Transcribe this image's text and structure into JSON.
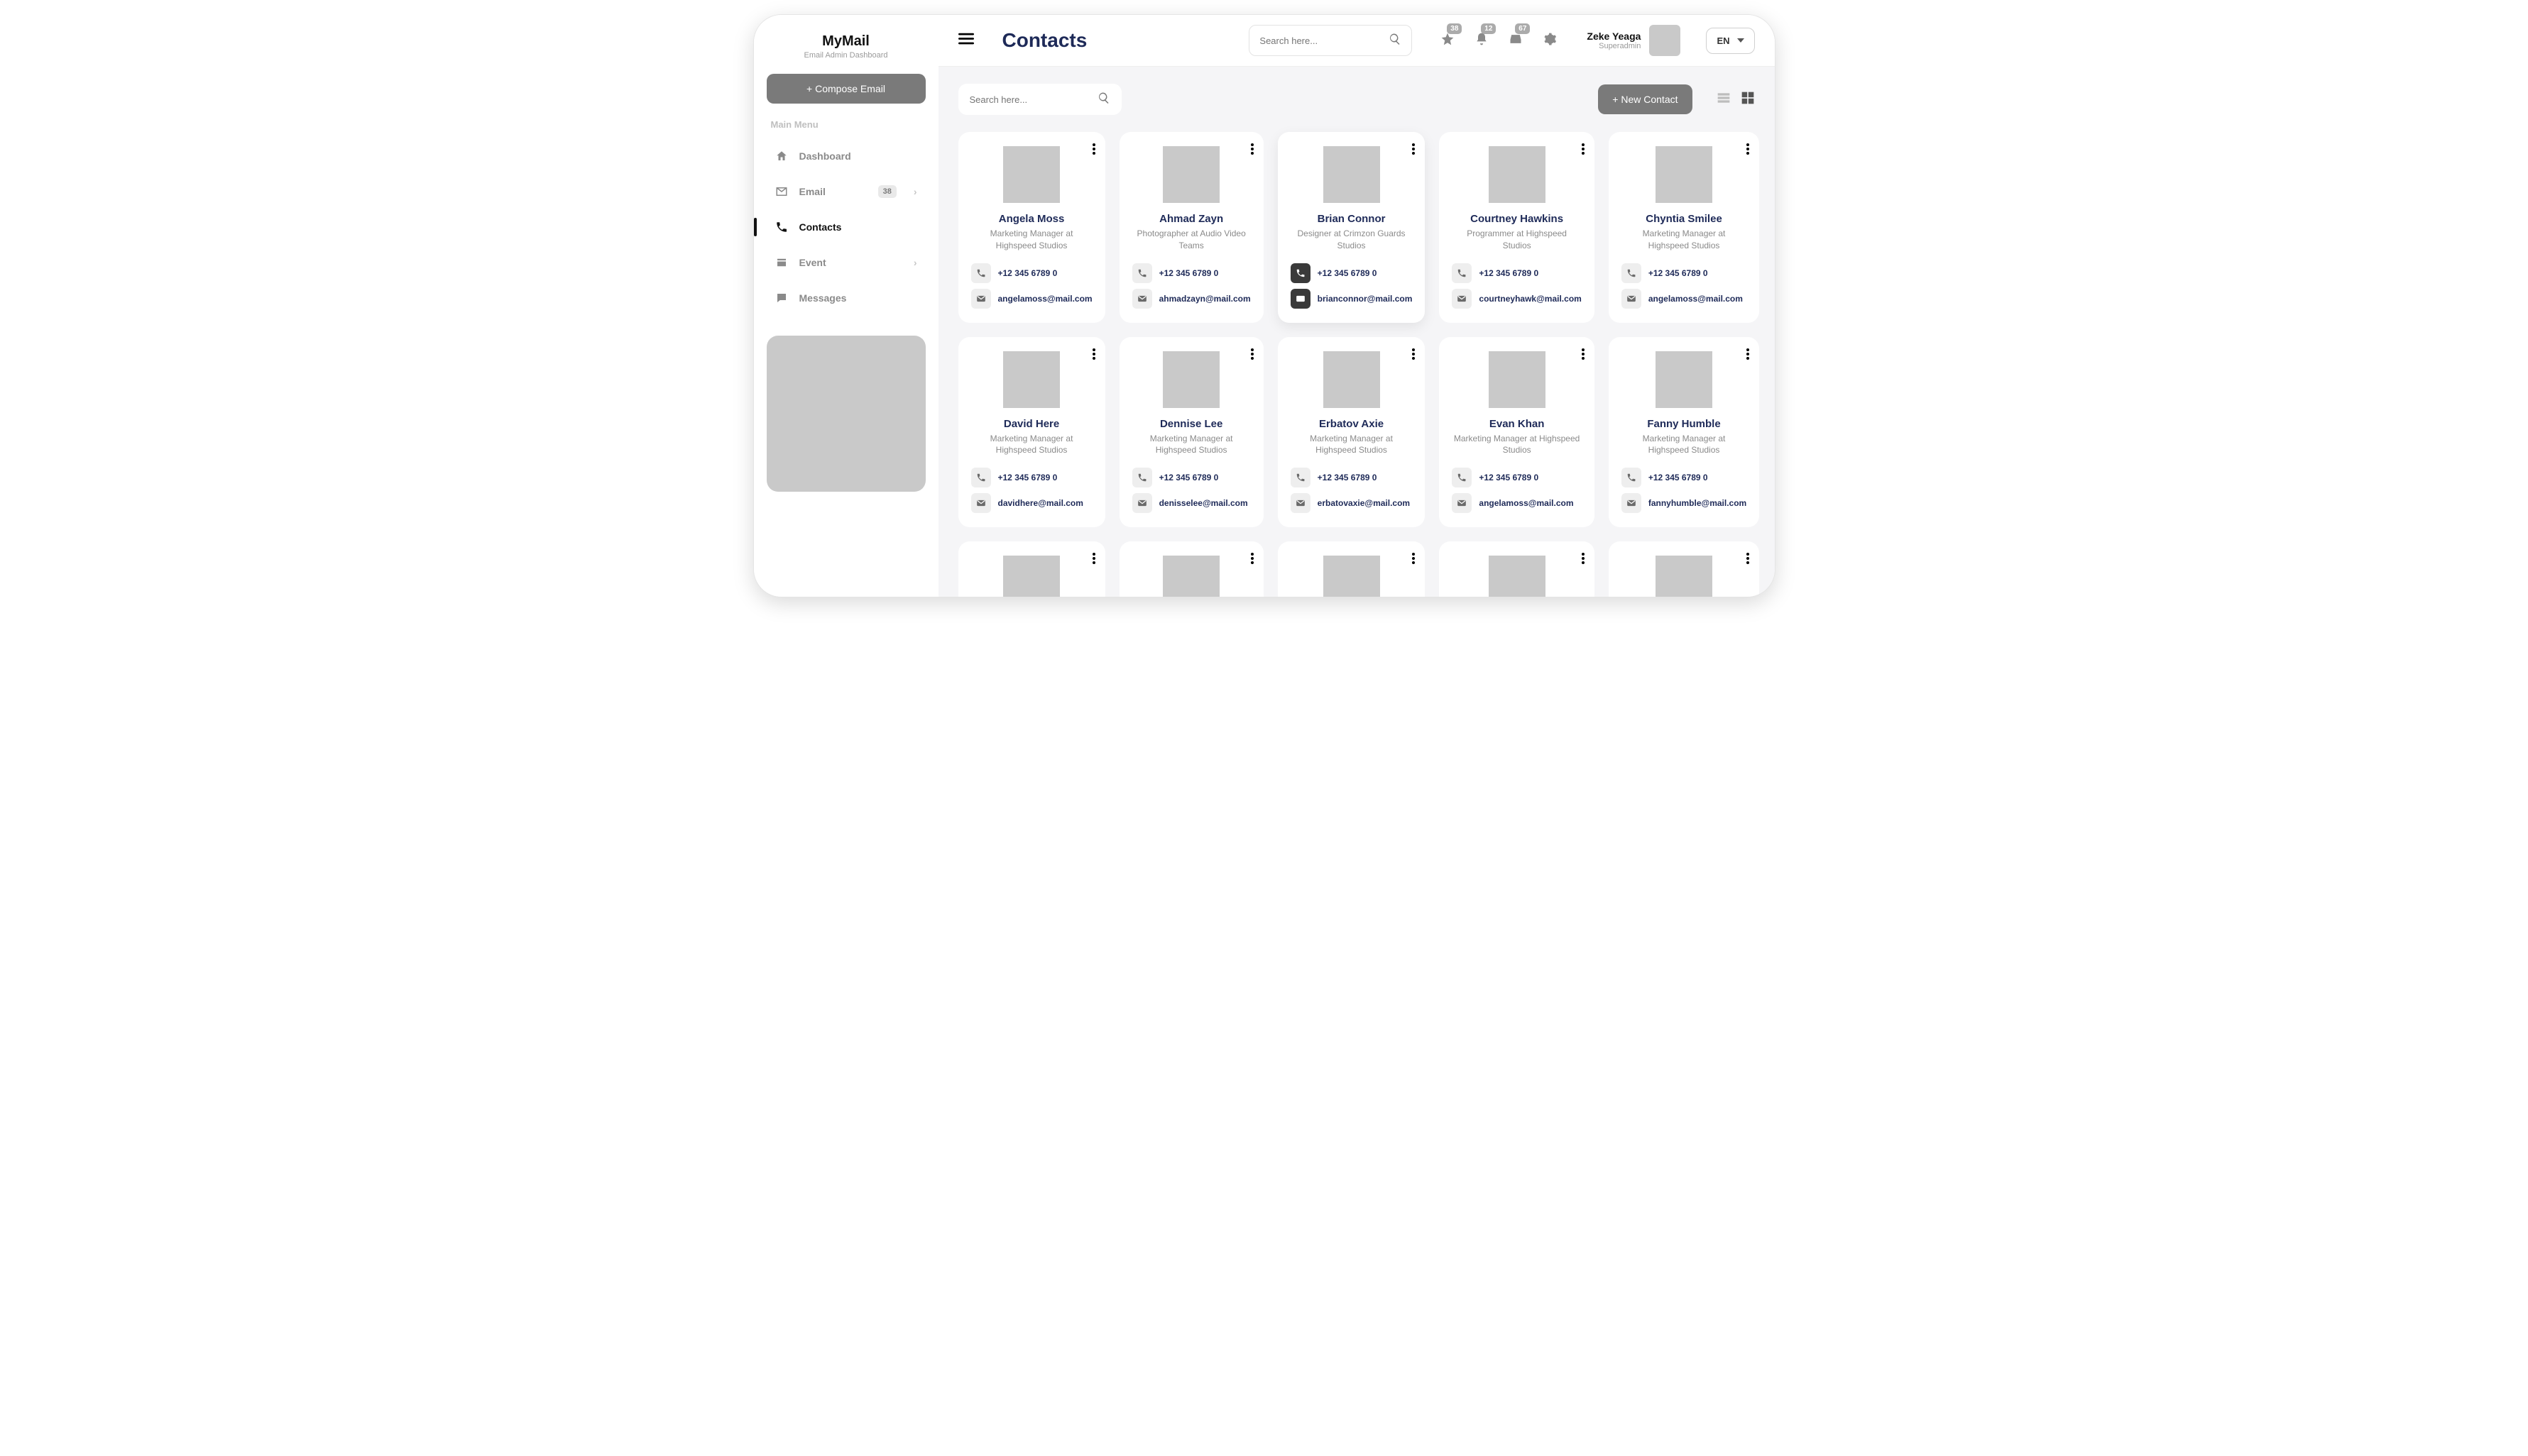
{
  "brand": {
    "title": "MyMail",
    "subtitle": "Email Admin Dashboard"
  },
  "sidebar": {
    "compose_label": "+ Compose Email",
    "menu_label": "Main Menu",
    "items": [
      {
        "label": "Dashboard"
      },
      {
        "label": "Email",
        "badge": "38"
      },
      {
        "label": "Contacts"
      },
      {
        "label": "Event"
      },
      {
        "label": "Messages"
      }
    ]
  },
  "header": {
    "title": "Contacts",
    "search_placeholder": "Search here...",
    "badges": {
      "star": "38",
      "bell": "12",
      "inbox": "67"
    },
    "user": {
      "name": "Zeke Yeaga",
      "role": "Superadmin"
    },
    "lang": "EN"
  },
  "toolbar": {
    "search_placeholder": "Search here...",
    "new_contact_label": "+ New Contact"
  },
  "contacts": [
    {
      "name": "Angela Moss",
      "role": "Marketing Manager at Highspeed Studios",
      "phone": "+12 345 6789 0",
      "email": "angelamoss@mail.com"
    },
    {
      "name": "Ahmad Zayn",
      "role": "Photographer at Audio Video Teams",
      "phone": "+12 345 6789 0",
      "email": "ahmadzayn@mail.com"
    },
    {
      "name": "Brian Connor",
      "role": "Designer at Crimzon Guards Studios",
      "phone": "+12 345 6789 0",
      "email": "brianconnor@mail.com",
      "selected": true
    },
    {
      "name": "Courtney Hawkins",
      "role": "Programmer at Highspeed Studios",
      "phone": "+12 345 6789 0",
      "email": "courtneyhawk@mail.com"
    },
    {
      "name": "Chyntia Smilee",
      "role": "Marketing Manager at Highspeed Studios",
      "phone": "+12 345 6789 0",
      "email": "angelamoss@mail.com"
    },
    {
      "name": "David Here",
      "role": "Marketing Manager at Highspeed Studios",
      "phone": "+12 345 6789 0",
      "email": "davidhere@mail.com"
    },
    {
      "name": "Dennise Lee",
      "role": "Marketing Manager at Highspeed Studios",
      "phone": "+12 345 6789 0",
      "email": "denisselee@mail.com"
    },
    {
      "name": "Erbatov Axie",
      "role": "Marketing Manager at Highspeed Studios",
      "phone": "+12 345 6789 0",
      "email": "erbatovaxie@mail.com"
    },
    {
      "name": "Evan Khan",
      "role": "Marketing Manager at Highspeed Studios",
      "phone": "+12 345 6789 0",
      "email": "angelamoss@mail.com"
    },
    {
      "name": "Fanny Humble",
      "role": "Marketing Manager at Highspeed Studios",
      "phone": "+12 345 6789 0",
      "email": "fannyhumble@mail.com"
    },
    {
      "name": "",
      "role": "",
      "phone": "",
      "email": "",
      "partial": true
    },
    {
      "name": "",
      "role": "",
      "phone": "",
      "email": "",
      "partial": true
    },
    {
      "name": "",
      "role": "",
      "phone": "",
      "email": "",
      "partial": true
    },
    {
      "name": "",
      "role": "",
      "phone": "",
      "email": "",
      "partial": true
    },
    {
      "name": "",
      "role": "",
      "phone": "",
      "email": "",
      "partial": true
    }
  ]
}
